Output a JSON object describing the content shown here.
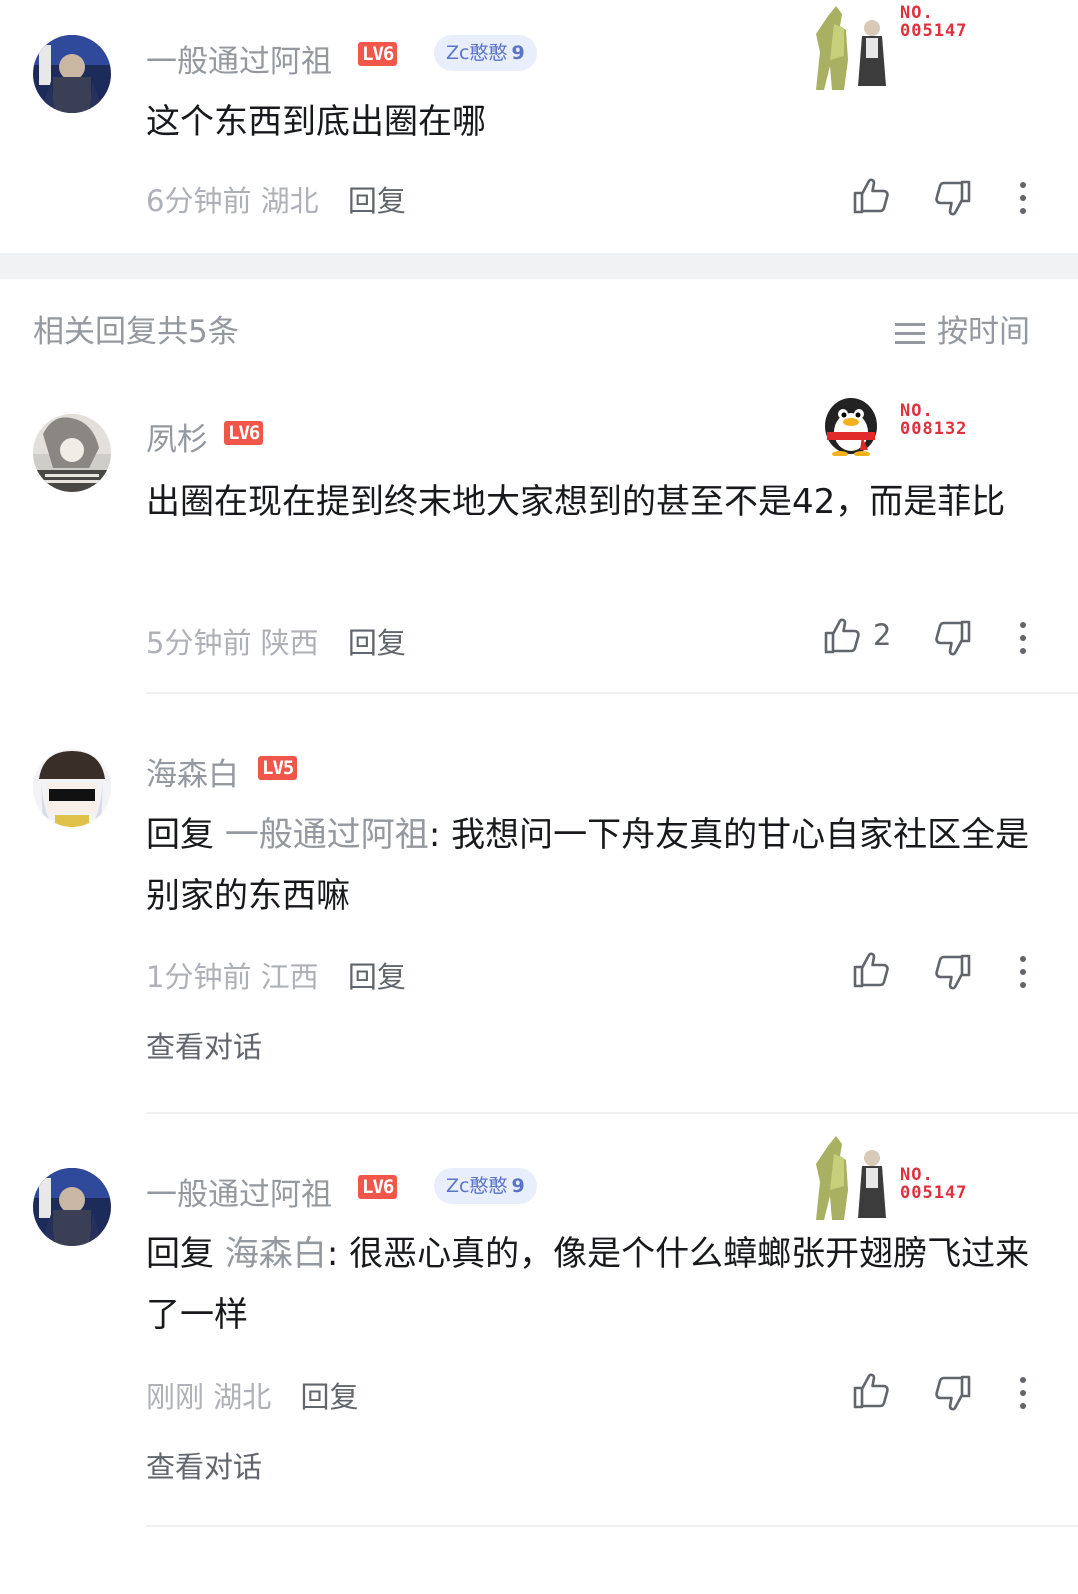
{
  "root_comment": {
    "username": "一般通过阿祖",
    "level": "LV6",
    "fan_badge": {
      "name": "Zc憨憨",
      "level": "9"
    },
    "card_no": "NO.\n005147",
    "content": "这个东西到底出圈在哪",
    "time": "6分钟前",
    "location": "湖北",
    "reply_label": "回复"
  },
  "related": {
    "title": "相关回复共5条",
    "sort_label": "按时间"
  },
  "replies": [
    {
      "username": "夙杉",
      "level": "LV6",
      "card_no": "NO.\n008132",
      "content": "出圈在现在提到终末地大家想到的甚至不是42，而是菲比",
      "time": "5分钟前",
      "location": "陕西",
      "reply_label": "回复",
      "likes": "2"
    },
    {
      "username": "海森白",
      "level": "LV5",
      "reply_prefix": "回复 ",
      "mention": "一般通过阿祖",
      "content": ": 我想问一下舟友真的甘心自家社区全是别家的东西嘛",
      "time": "1分钟前",
      "location": "江西",
      "reply_label": "回复",
      "view_conversation": "查看对话"
    },
    {
      "username": "一般通过阿祖",
      "level": "LV6",
      "fan_badge": {
        "name": "Zc憨憨",
        "level": "9"
      },
      "card_no": "NO.\n005147",
      "reply_prefix": "回复 ",
      "mention": "海森白",
      "content": ": 很恶心真的，像是个什么蟑螂张开翅膀飞过来了一样",
      "time": "刚刚",
      "location": "湖北",
      "reply_label": "回复",
      "view_conversation": "查看对话"
    }
  ],
  "colors": {
    "accent_red": "#e0303d",
    "level_badge": "#f0564a",
    "fan_badge_bg": "#e8eefc",
    "muted_text": "#9499a0"
  }
}
